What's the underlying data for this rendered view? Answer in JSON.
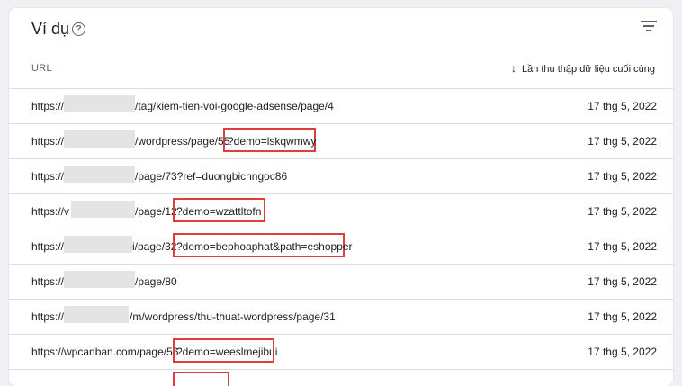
{
  "card": {
    "title": "Ví dụ",
    "help_glyph": "?",
    "columns": {
      "url": "URL",
      "date": "Lần thu thập dữ liệu cuối cùng",
      "sort_icon": "arrow-down-icon"
    }
  },
  "rows": [
    {
      "prefix": "https://",
      "tail": "/tag/kiem-tien-voi-google-adsense/page/4",
      "highlight": "",
      "date": "17 thg 5, 2022"
    },
    {
      "prefix": "https://",
      "tail": "/wordpress/page/55",
      "highlight": "?demo=lskqwmwy",
      "date": "17 thg 5, 2022"
    },
    {
      "prefix": "https://",
      "tail": "/page/73?ref=duongbichngoc86",
      "highlight": "",
      "date": "17 thg 5, 2022"
    },
    {
      "prefix": "https://v",
      "tail": "/page/12",
      "highlight": "?demo=wzattltofn",
      "date": "17 thg 5, 2022"
    },
    {
      "prefix": "https://",
      "tail": "i/page/32",
      "highlight": "?demo=bephoaphat&path=eshopper",
      "date": "17 thg 5, 2022"
    },
    {
      "prefix": "https://",
      "tail": "/page/80",
      "highlight": "",
      "date": "17 thg 5, 2022"
    },
    {
      "prefix": "https://",
      "tail": "/m/wordpress/thu-thuat-wordpress/page/31",
      "highlight": "",
      "date": "17 thg 5, 2022"
    },
    {
      "prefix": "https://wpcanban.com/page/56",
      "tail": "",
      "highlight": "?demo=weeslmejibui",
      "date": "17 thg 5, 2022"
    }
  ]
}
